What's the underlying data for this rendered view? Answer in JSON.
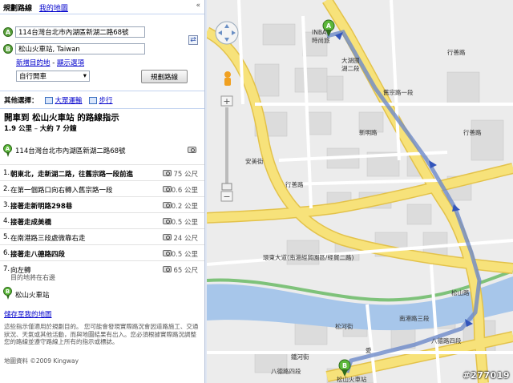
{
  "tabs": {
    "directions": "規劃路線",
    "my_maps": "我的地圖"
  },
  "collapse_glyph": "«",
  "inputs": {
    "a": {
      "marker": "A",
      "value": "114台灣台北市內湖區新湖二路68號"
    },
    "b": {
      "marker": "B",
      "value": "松山火車站, Taiwan"
    }
  },
  "links": {
    "add_destination": "新增目的地",
    "separator": " - ",
    "show_options": "顯示選項"
  },
  "mode_select": {
    "selected": "自行開車"
  },
  "plan_button": "規劃路線",
  "other_options": {
    "label": "其他選擇：",
    "transit": "大眾運輸",
    "walking": "步行"
  },
  "directions": {
    "title": "開車到 松山火車站 的路線指示",
    "distance": "1.9 公里",
    "sep": " – ",
    "time": "大約 7 分鐘",
    "start": {
      "marker": "A",
      "address": "114台灣台北市內湖區新湖二路68號"
    },
    "steps": [
      {
        "num": "1.",
        "text": "朝東北，走新湖二路，往舊宗路一段前進",
        "dist": "75 公尺"
      },
      {
        "num": "2.",
        "text": "在第一個路口向右轉入舊宗路一段",
        "dist": "0.6 公里"
      },
      {
        "num": "3.",
        "text": "接著走新明路298巷",
        "dist": "0.2 公里"
      },
      {
        "num": "4.",
        "text": "接著走成美橋",
        "dist": "0.5 公里"
      },
      {
        "num": "5.",
        "text": "在南港路三段處微靠右走",
        "dist": "24 公尺"
      },
      {
        "num": "6.",
        "text": "接著走八德路四段",
        "dist": "0.5 公里"
      },
      {
        "num": "7.",
        "text": "向左轉",
        "dist": "65 公尺",
        "sub": "目的地將在右邊"
      }
    ],
    "end": {
      "marker": "B",
      "address": "松山火車站"
    }
  },
  "save_link": "儲存至我的地圖",
  "disclaimer": "這些指示僅適用於規劃目的。 您可能會發現實際路況會因道路施工、交通狀況、天氣或其他活動，而與地圖結果有出入。您必須根據實際路況調整您的路線並遵守路線上所有的指示或標誌。",
  "copyright": "地圖資料 ©2009 Kingway",
  "watermark": "#277019",
  "map": {
    "labels": {
      "inba": "INBA",
      "hotel": "時尚旅",
      "dahu": "大湖國",
      "dahu2": "湖二段",
      "haojie": "行善路",
      "anmei": "安美街",
      "xinming": "新明路",
      "xinghu": "行善路",
      "jiuzong": "舊宗路一段",
      "shanxin": "行善路",
      "tonghua": "環東大道(南港經貿園區/經貿二路)",
      "songshan": "松山路",
      "nangang": "南港路三段",
      "bade": "八德路四段",
      "bade2": "八德路四段",
      "songhe": "松河街",
      "songshan_st": "松山火車站",
      "ai": "愛",
      "dutong": "鐵河街"
    },
    "colors": {
      "road_major": "#f7e27a",
      "road_edge": "#e3c24a",
      "river": "#a7c6ea",
      "route": "#6d89c9",
      "block": "#dadada"
    }
  }
}
